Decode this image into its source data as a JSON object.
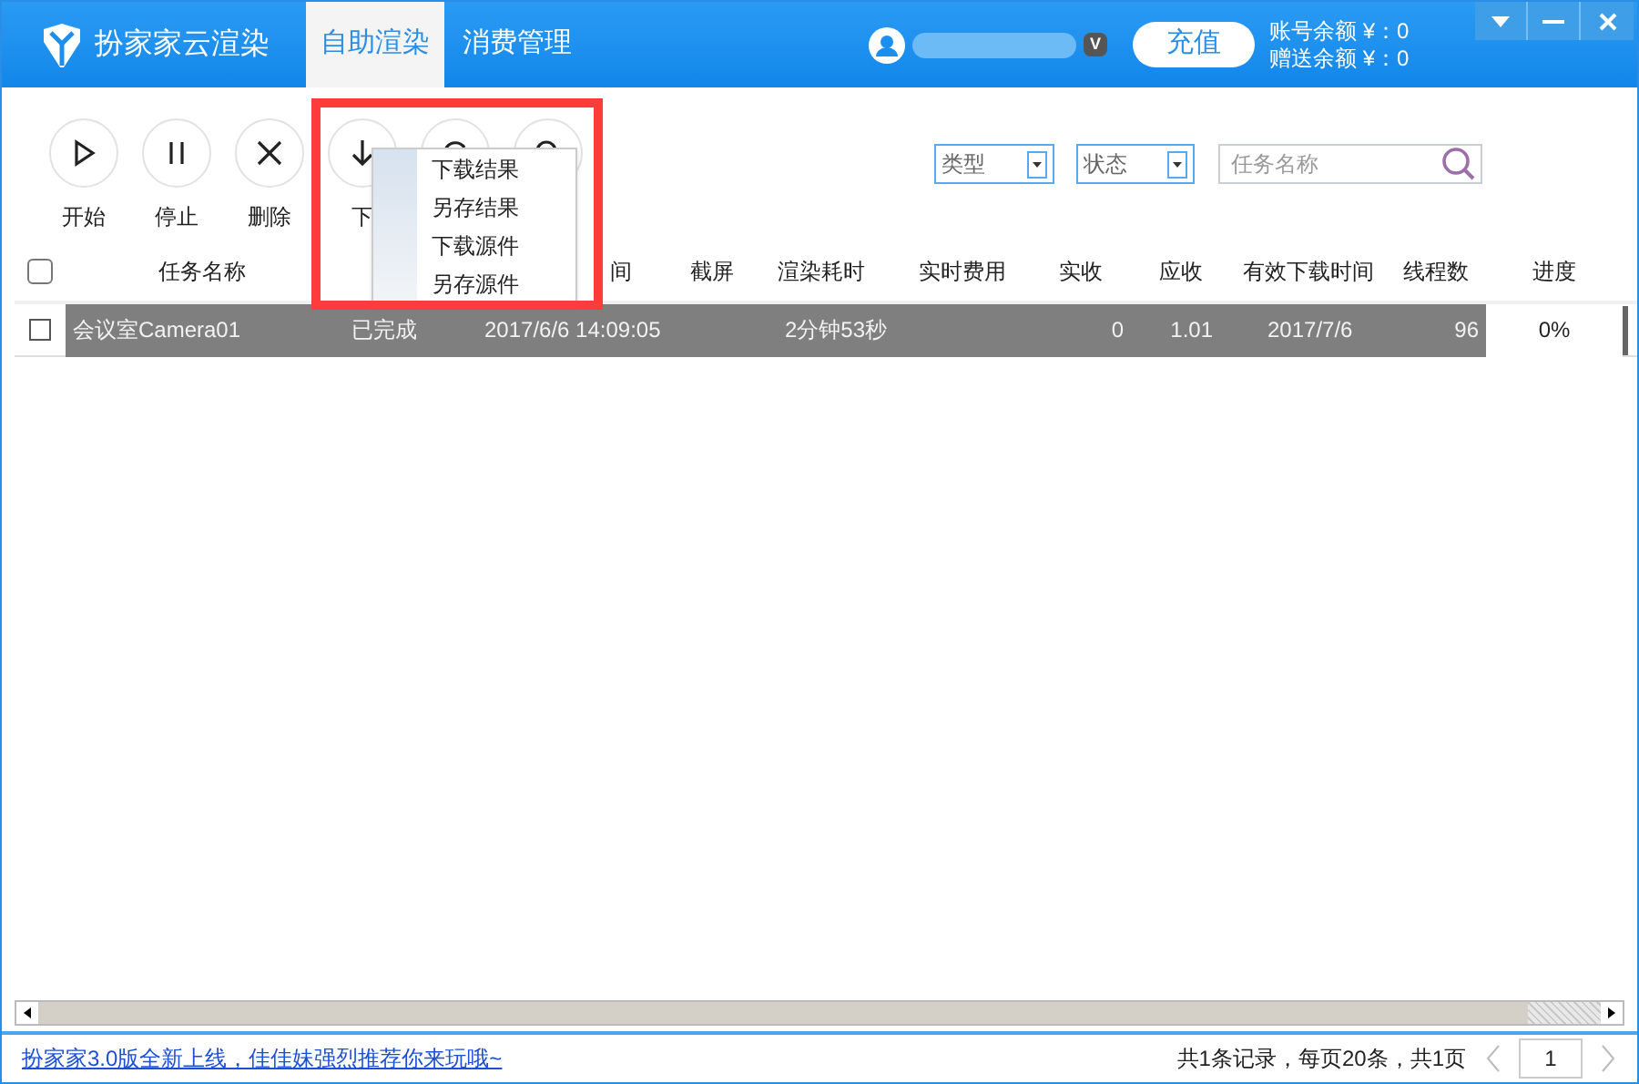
{
  "app": {
    "title": "扮家家云渲染"
  },
  "nav_tabs": [
    {
      "label": "自助渲染",
      "selected": true
    },
    {
      "label": "消费管理",
      "selected": false
    }
  ],
  "user": {
    "vip_badge": "V",
    "recharge_button": "充值",
    "balance": "账号余额 ¥：0",
    "gift_balance": "赠送余额 ¥：0"
  },
  "toolbar": [
    {
      "kind": "play",
      "label": "开始"
    },
    {
      "kind": "pause",
      "label": "停止"
    },
    {
      "kind": "delete",
      "label": "删除"
    },
    {
      "kind": "download",
      "label": "下"
    },
    {
      "kind": "refresh"
    },
    {
      "kind": "search"
    }
  ],
  "download_menu": [
    "下载结果",
    "另存结果",
    "下载源件",
    "另存源件"
  ],
  "filters": {
    "type_select": "类型",
    "status_select": "状态",
    "search": {
      "placeholder": "任务名称"
    }
  },
  "table": {
    "header_checked": false,
    "columns": [
      {
        "kind": "name",
        "label": "任务名称"
      },
      {
        "kind": "status"
      },
      {
        "kind": "time",
        "label": "间"
      },
      {
        "kind": "shot",
        "label": "截屏"
      },
      {
        "kind": "duration",
        "label": "渲染耗时"
      },
      {
        "kind": "cost",
        "label": "实时费用"
      },
      {
        "kind": "received",
        "label": "实收"
      },
      {
        "kind": "due",
        "label": "应收"
      },
      {
        "kind": "valid",
        "label": "有效下载时间"
      },
      {
        "kind": "threads",
        "label": "线程数"
      },
      {
        "kind": "progress",
        "label": "进度"
      }
    ],
    "rows": [
      {
        "selected": true,
        "checked": false,
        "cells": [
          "会议室Camera01",
          "已完成",
          "2017/6/6 14:09:05",
          "",
          "2分钟53秒",
          "",
          "0",
          "1.01",
          "2017/7/6",
          "96",
          "0%"
        ]
      }
    ]
  },
  "footer": {
    "link": "扮家家3.0版全新上线，佳佳妹强烈推荐你来玩哦~",
    "summary": "共1条记录，每页20条，共1页",
    "page": "1"
  }
}
